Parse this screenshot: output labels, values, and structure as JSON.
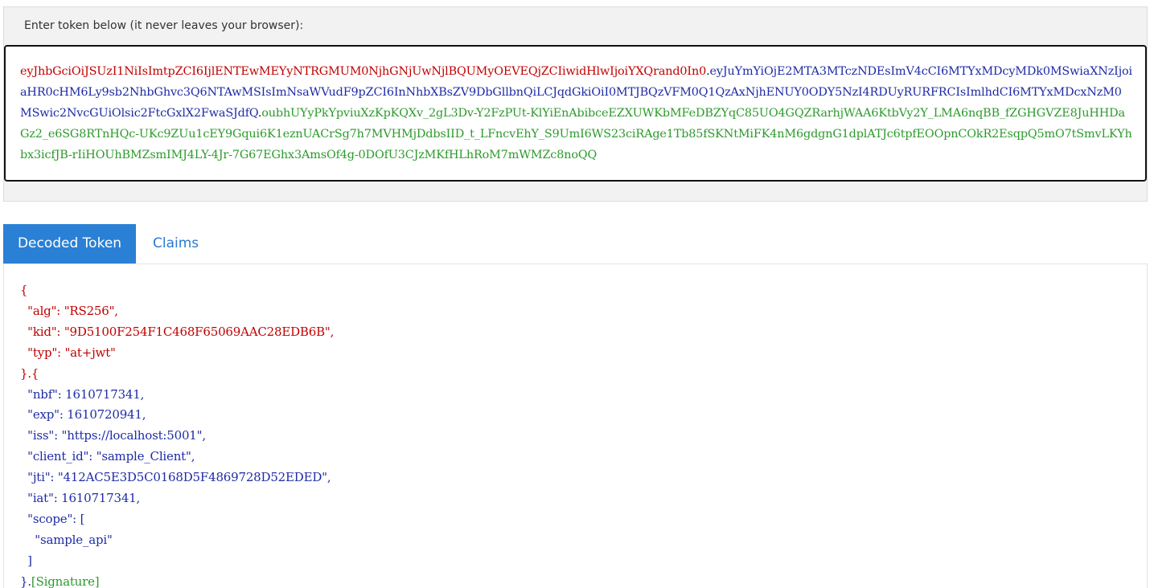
{
  "token_section": {
    "label": "Enter token below (it never leaves your browser):",
    "header": "eyJhbGciOiJSUzI1NiIsImtpZCI6IjlENTEwMEYyNTRGMUM0NjhGNjUwNjlBQUMyOEVEQjZCIiwidHlwIjoiYXQrand0In0",
    "payload": "eyJuYmYiOjE2MTA3MTczNDEsImV4cCI6MTYxMDcyMDk0MSwiaXNzIjoiaHR0cHM6Ly9sb2NhbGhvc3Q6NTAwMSIsImNsaWVudF9pZCI6InNhbXBsZV9DbGllbnQiLCJqdGkiOiI0MTJBQzVFM0Q1QzAxNjhENUY0ODY5NzI4RDUyRURFRCIsImlhdCI6MTYxMDcxNzM0MSwic2NvcGUiOlsic2FtcGxlX2FwaSJdfQ",
    "signature": "oubhUYyPkYpviuXzKpKQXv_2gL3Dv-Y2FzPUt-KlYiEnAbibceEZXUWKbMFeDBZYqC85UO4GQZRarhjWAA6KtbVy2Y_LMA6nqBB_fZGHGVZE8JuHHDaGz2_e6SG8RTnHQc-UKc9ZUu1cEY9Gqui6K1eznUACrSg7h7MVHMjDdbsIID_t_LFncvEhY_S9UmI6WS23ciRAge1Tb85fSKNtMiFK4nM6gdgnG1dplATJc6tpfEOOpnCOkR2EsqpQ5mO7tSmvLKYhbx3icfJB-rIiHOUhBMZsmIMJ4LY-4Jr-7G67EGhx3AmsOf4g-0DOfU3CJzMKfHLhRoM7mWMZc8noQQ",
    "dot": "."
  },
  "tabs": {
    "decoded_label": "Decoded Token",
    "claims_label": "Claims"
  },
  "decoded": {
    "open_brace": "{",
    "header_lines": [
      "  \"alg\": \"RS256\",",
      "  \"kid\": \"9D5100F254F1C468F65069AAC28EDB6B\",",
      "  \"typ\": \"at+jwt\""
    ],
    "header_close": "}.{",
    "payload_lines": [
      "  \"nbf\": 1610717341,",
      "  \"exp\": 1610720941,",
      "  \"iss\": \"https://localhost:5001\",",
      "  \"client_id\": \"sample_Client\",",
      "  \"jti\": \"412AC5E3D5C0168D5F4869728D52EDED\",",
      "  \"iat\": 1610717341,",
      "  \"scope\": [",
      "    \"sample_api\"",
      "  ]"
    ],
    "payload_close": "}.",
    "signature_label": "[Signature]"
  },
  "colors": {
    "header": "#c00000",
    "payload": "#1e2ba6",
    "signature": "#2c9a2c",
    "tab_active_bg": "#2a80d5",
    "tab_inactive_text": "#2a7ad0"
  }
}
